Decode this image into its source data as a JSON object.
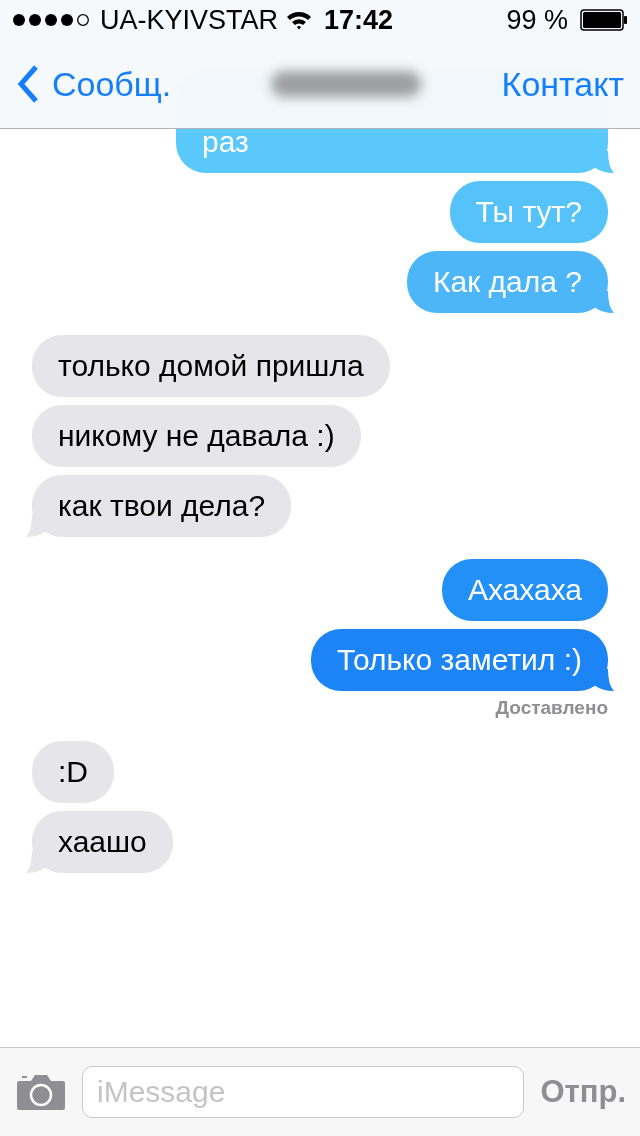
{
  "status_bar": {
    "carrier": "UA-KYIVSTAR",
    "time": "17:42",
    "battery": "99 %"
  },
  "nav": {
    "back": "Сообщ.",
    "action": "Контакт"
  },
  "messages": [
    {
      "kind": "out",
      "text": "раз",
      "color": "#5ac8fa",
      "tail": true
    },
    {
      "kind": "out",
      "text": "Ты тут?",
      "color": "#55c2fa",
      "tail": false
    },
    {
      "kind": "out",
      "text": "Как дала ?",
      "color": "#4cb6f9",
      "tail": true
    },
    {
      "kind": "in",
      "text": "только домой пришла",
      "tail": false
    },
    {
      "kind": "in",
      "text": "никому не давала :)",
      "tail": false
    },
    {
      "kind": "in",
      "text": "как твои дела?",
      "tail": true
    },
    {
      "kind": "out",
      "text": "Ахахаха",
      "color": "#2290f6",
      "tail": false
    },
    {
      "kind": "out",
      "text": "Только заметил :)",
      "color": "#1d84f5",
      "tail": true,
      "status": "Доставлено"
    },
    {
      "kind": "in",
      "text": ":D",
      "tail": false
    },
    {
      "kind": "in",
      "text": "хаашо",
      "tail": true
    }
  ],
  "composer": {
    "placeholder": "iMessage",
    "send": "Отпр."
  }
}
